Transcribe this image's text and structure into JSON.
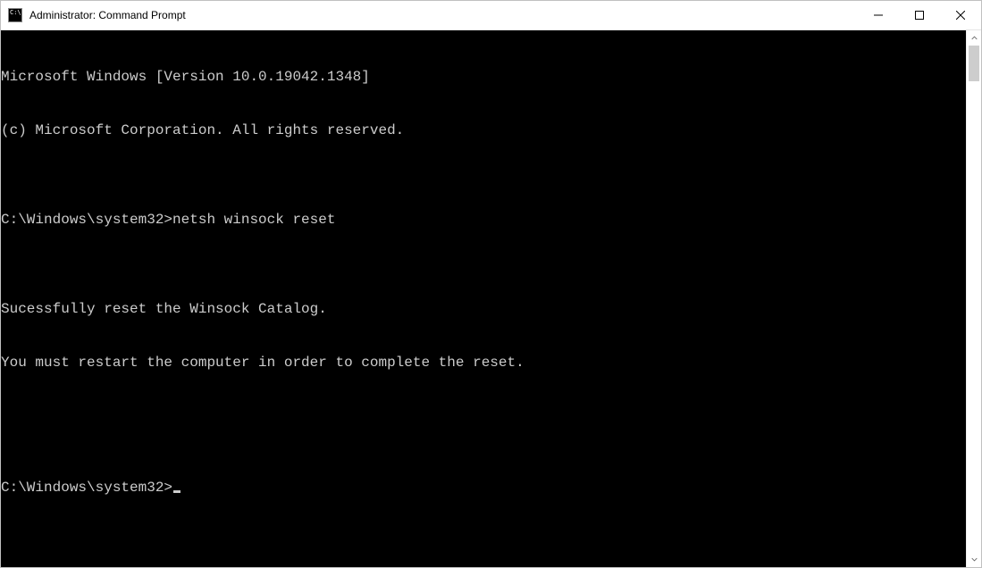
{
  "window": {
    "title": "Administrator: Command Prompt"
  },
  "terminal": {
    "lines": [
      "Microsoft Windows [Version 10.0.19042.1348]",
      "(c) Microsoft Corporation. All rights reserved.",
      "",
      "C:\\Windows\\system32>netsh winsock reset",
      "",
      "Sucessfully reset the Winsock Catalog.",
      "You must restart the computer in order to complete the reset.",
      "",
      "",
      "C:\\Windows\\system32>"
    ]
  }
}
